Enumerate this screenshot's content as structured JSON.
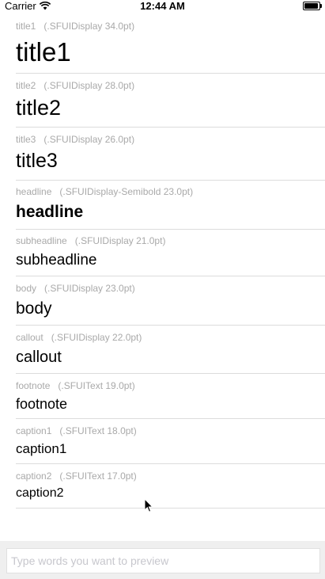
{
  "status": {
    "carrier": "Carrier",
    "time": "12:44 AM"
  },
  "styles": [
    {
      "name": "title1",
      "font": "(.SFUIDisplay 34.0pt)",
      "sample": "title1"
    },
    {
      "name": "title2",
      "font": "(.SFUIDisplay 28.0pt)",
      "sample": "title2"
    },
    {
      "name": "title3",
      "font": "(.SFUIDisplay 26.0pt)",
      "sample": "title3"
    },
    {
      "name": "headline",
      "font": "(.SFUIDisplay-Semibold 23.0pt)",
      "sample": "headline"
    },
    {
      "name": "subheadline",
      "font": "(.SFUIDisplay 21.0pt)",
      "sample": "subheadline"
    },
    {
      "name": "body",
      "font": "(.SFUIDisplay 23.0pt)",
      "sample": "body"
    },
    {
      "name": "callout",
      "font": "(.SFUIDisplay 22.0pt)",
      "sample": "callout"
    },
    {
      "name": "footnote",
      "font": "(.SFUIText 19.0pt)",
      "sample": "footnote"
    },
    {
      "name": "caption1",
      "font": "(.SFUIText 18.0pt)",
      "sample": "caption1"
    },
    {
      "name": "caption2",
      "font": "(.SFUIText 17.0pt)",
      "sample": "caption2"
    }
  ],
  "input": {
    "placeholder": "Type words you want to preview",
    "value": ""
  }
}
